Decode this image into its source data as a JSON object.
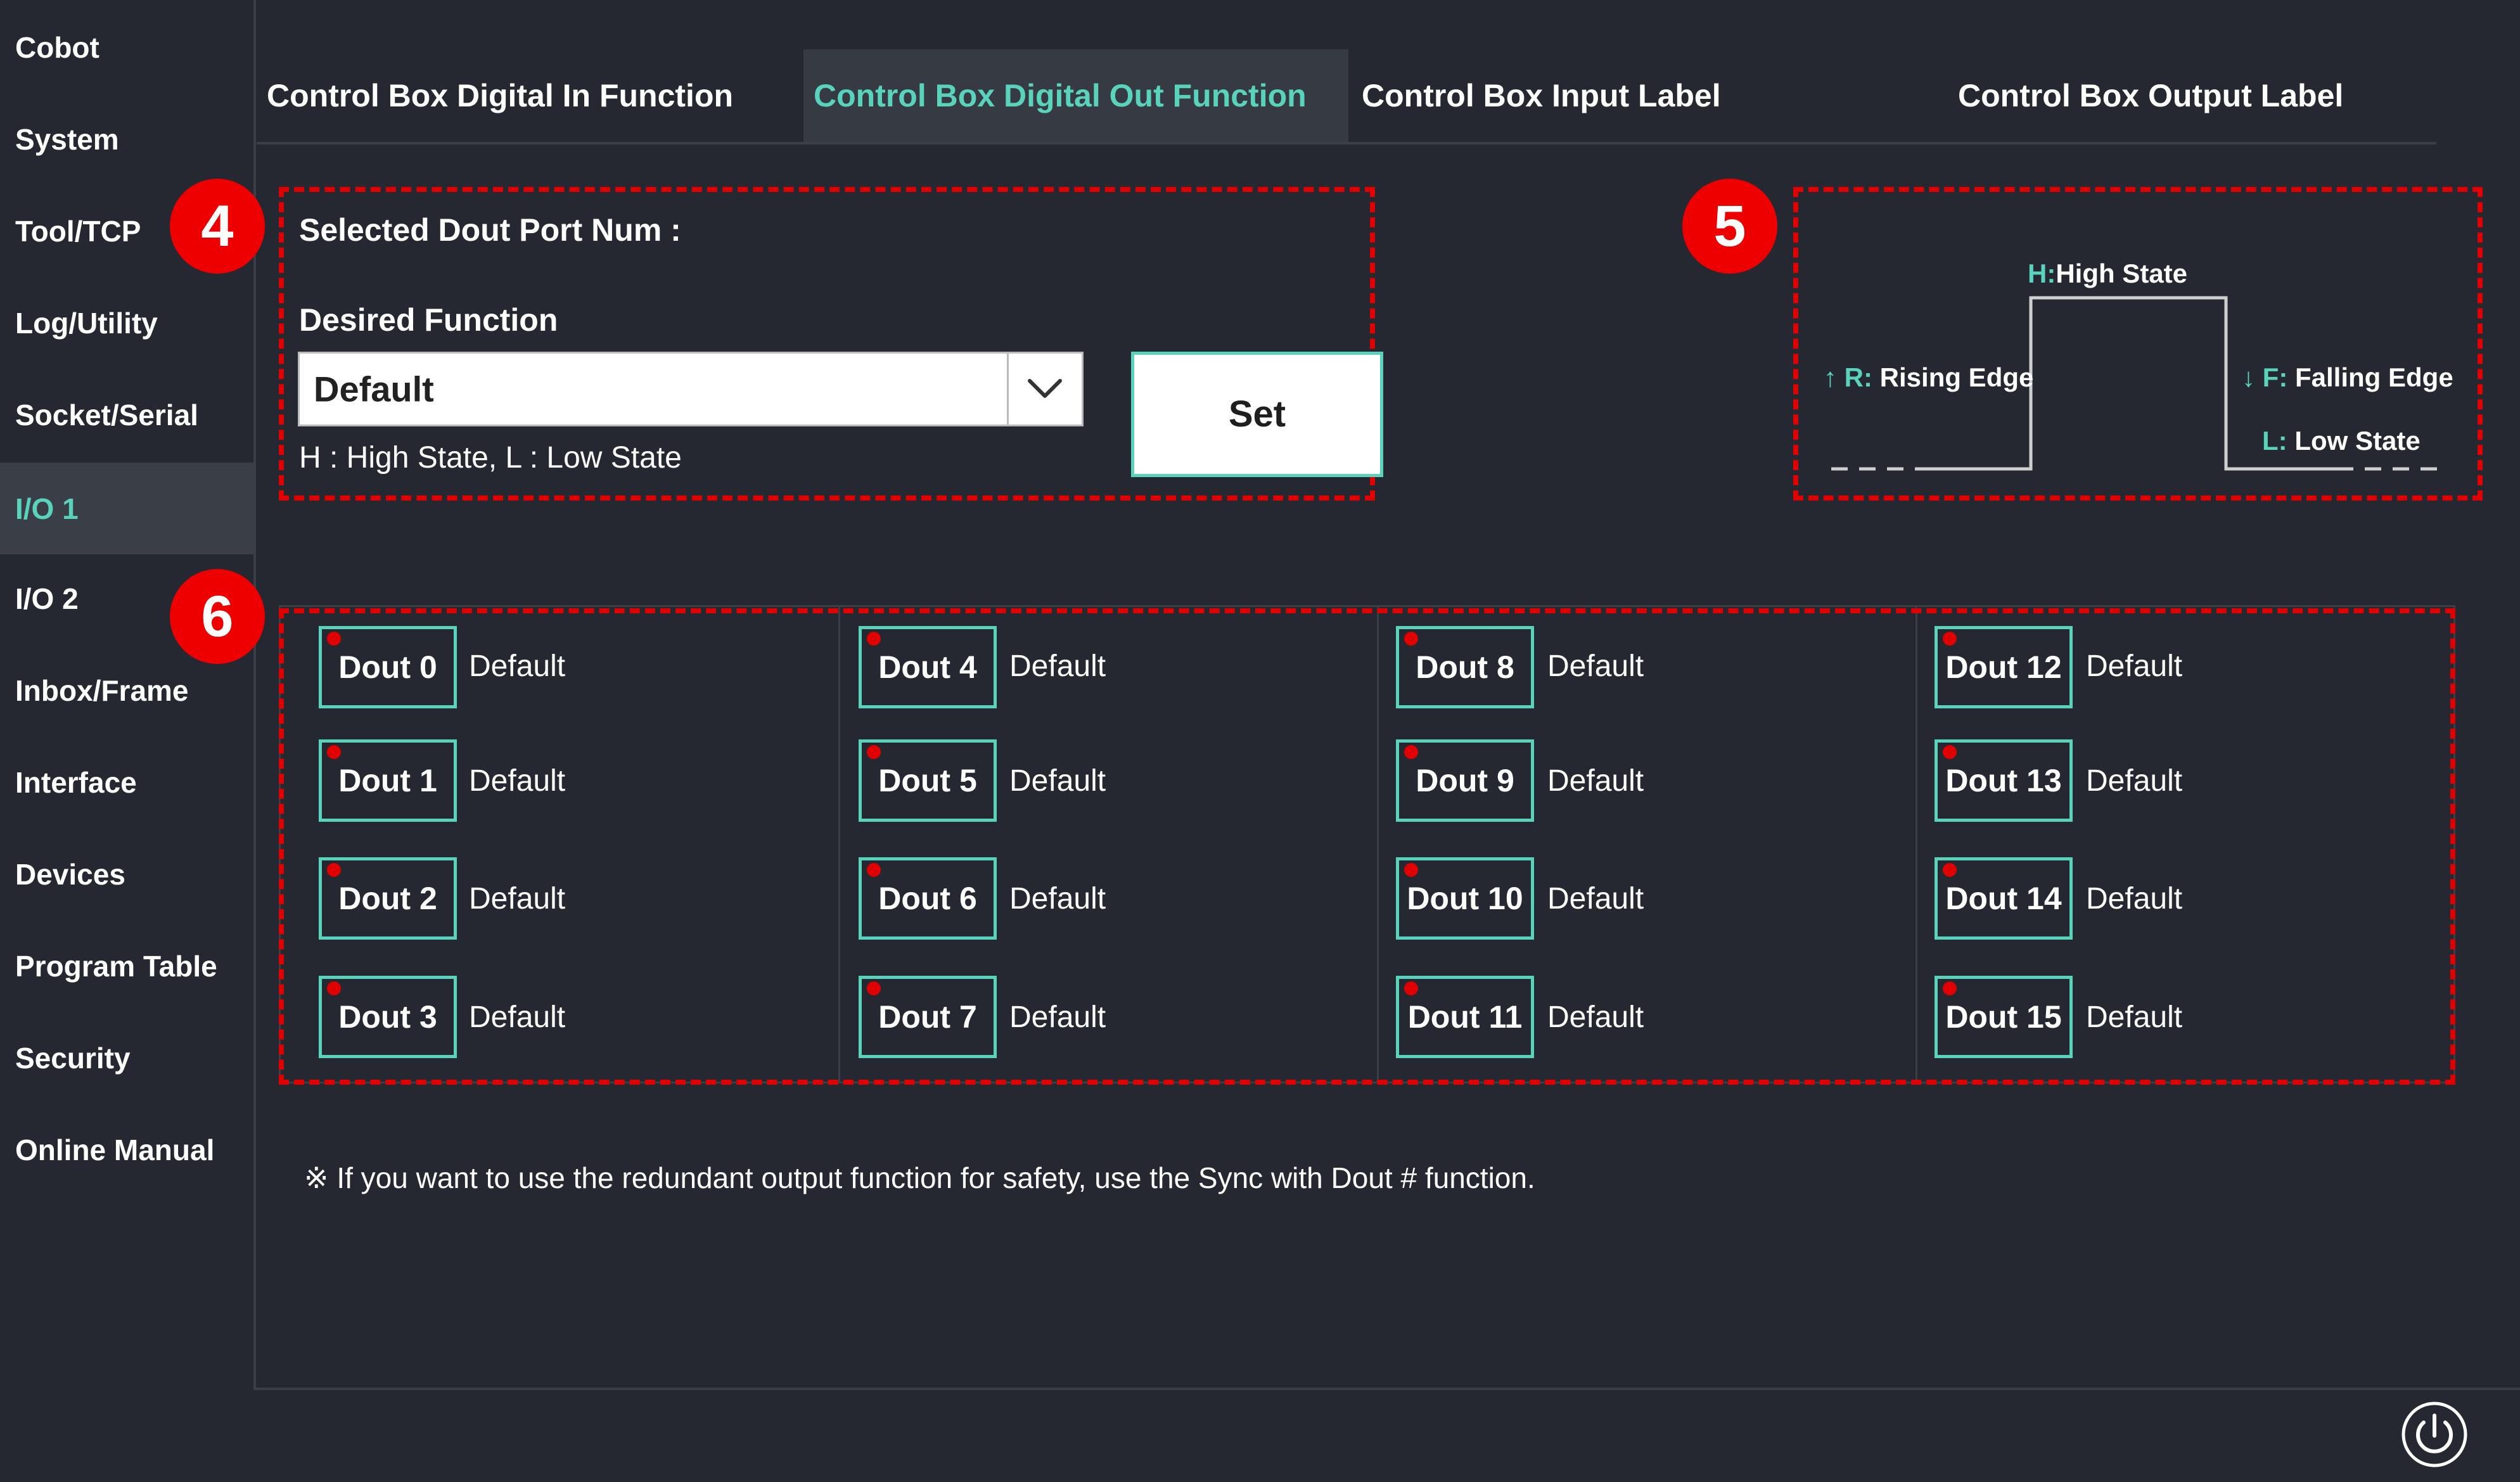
{
  "sidebar": {
    "items": [
      {
        "label": "Cobot"
      },
      {
        "label": "System"
      },
      {
        "label": "Tool/TCP"
      },
      {
        "label": "Log/Utility"
      },
      {
        "label": "Socket/Serial"
      },
      {
        "label": "I/O 1",
        "active": true
      },
      {
        "label": "I/O 2"
      },
      {
        "label": "Inbox/Frame"
      },
      {
        "label": "Interface"
      },
      {
        "label": "Devices"
      },
      {
        "label": "Program Table"
      },
      {
        "label": "Security"
      },
      {
        "label": "Online Manual"
      }
    ]
  },
  "tabs": [
    {
      "label": "Control Box Digital In Function"
    },
    {
      "label": "Control Box Digital Out Function",
      "active": true
    },
    {
      "label": "Control Box Input Label"
    },
    {
      "label": "Control Box Output Label"
    }
  ],
  "settings": {
    "selected_port_label": "Selected Dout Port Num :",
    "desired_function_label": "Desired Function",
    "function_value": "Default",
    "legend": "H : High State, L : Low State",
    "set_label": "Set"
  },
  "signal_diagram": {
    "high_state": {
      "key": "H:",
      "text": "High State"
    },
    "rising_edge": {
      "arrow": "↑",
      "key": "R:",
      "text": "Rising Edge"
    },
    "falling_edge": {
      "arrow": "↓",
      "key": "F:",
      "text": "Falling Edge"
    },
    "low_state": {
      "key": "L:",
      "text": "Low State"
    }
  },
  "badges": {
    "settings": "4",
    "diagram": "5",
    "grid": "6"
  },
  "dout_ports": [
    {
      "label": "Dout 0",
      "value": "Default"
    },
    {
      "label": "Dout 1",
      "value": "Default"
    },
    {
      "label": "Dout 2",
      "value": "Default"
    },
    {
      "label": "Dout 3",
      "value": "Default"
    },
    {
      "label": "Dout 4",
      "value": "Default"
    },
    {
      "label": "Dout 5",
      "value": "Default"
    },
    {
      "label": "Dout 6",
      "value": "Default"
    },
    {
      "label": "Dout 7",
      "value": "Default"
    },
    {
      "label": "Dout 8",
      "value": "Default"
    },
    {
      "label": "Dout 9",
      "value": "Default"
    },
    {
      "label": "Dout 10",
      "value": "Default"
    },
    {
      "label": "Dout 11",
      "value": "Default"
    },
    {
      "label": "Dout 12",
      "value": "Default"
    },
    {
      "label": "Dout 13",
      "value": "Default"
    },
    {
      "label": "Dout 14",
      "value": "Default"
    },
    {
      "label": "Dout 15",
      "value": "Default"
    }
  ],
  "note": "※ If you want to use the redundant output function for safety, use the Sync with Dout # function.",
  "colors": {
    "background": "#252830",
    "panel": "#3a3e47",
    "accent": "#5ad3bd",
    "annotation": "#e00000",
    "port_indicator": "#e00000"
  },
  "icons": {
    "dropdown": "chevron-down-icon",
    "power": "power-icon"
  }
}
